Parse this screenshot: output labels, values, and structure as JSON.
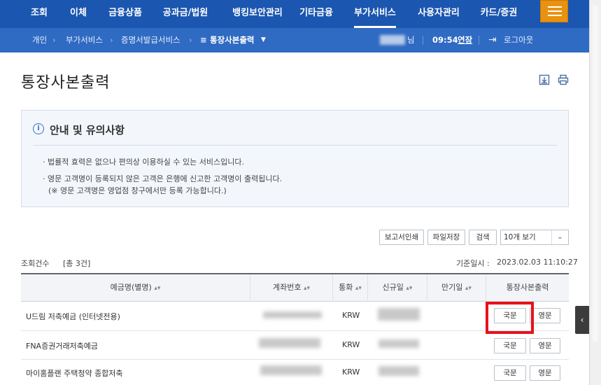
{
  "topnav": {
    "items": [
      "조회",
      "이체",
      "금융상품",
      "공과금/법원",
      "뱅킹보안관리",
      "기타금융",
      "부가서비스",
      "사용자관리",
      "카드/증권"
    ],
    "active": "부가서비스"
  },
  "breadcrumb": {
    "items": [
      "개인",
      "부가서비스",
      "증명서발급서비스"
    ],
    "current": "통장사본출력",
    "user_suffix": "님",
    "time": "09:54",
    "extend": "연장",
    "logout": "로그아웃"
  },
  "page": {
    "title": "통장사본출력"
  },
  "notice": {
    "heading": "안내 및 유의사항",
    "items": [
      "법률적 효력은 없으나 편의상 이용하실 수 있는 서비스입니다.",
      "영문 고객명이 등록되지 않은 고객은 은행에 신고한 고객명이 출력됩니다."
    ],
    "note": "(※ 영문 고객명은 영업점 창구에서만 등록 가능합니다.)"
  },
  "toolbar": {
    "report_print": "보고서인쇄",
    "file_save": "파일저장",
    "search": "검색",
    "page_size": "10개 보기"
  },
  "summary": {
    "count_label": "조회건수",
    "count_value": "[총 3건]",
    "base_label": "기준일시 :",
    "base_value": "2023.02.03 11:10:27"
  },
  "table": {
    "headers": [
      "예금명(별명)",
      "계좌번호",
      "통화",
      "신규일",
      "만기일",
      "통장사본출력"
    ],
    "rows": [
      {
        "name": "U드림 저축예금 (인터넷전용)",
        "currency": "KRW",
        "btn_kr": "국문",
        "btn_en": "영문"
      },
      {
        "name": "FNA증권거래저축예금",
        "currency": "KRW",
        "btn_kr": "국문",
        "btn_en": "영문"
      },
      {
        "name": "마이홈플랜 주택청약 종합저축",
        "currency": "KRW",
        "btn_kr": "국문",
        "btn_en": "영문"
      }
    ]
  },
  "colors": {
    "nav": "#1b56b0",
    "crumb": "#2f6ac3",
    "menu_button": "#e8920f",
    "highlight": "#e8111b"
  }
}
